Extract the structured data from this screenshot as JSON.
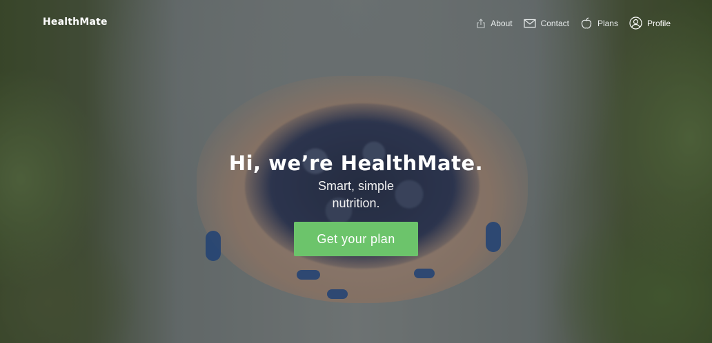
{
  "brand": {
    "name": "HealthMate"
  },
  "nav": {
    "items": [
      {
        "label": "About",
        "icon": "share-icon"
      },
      {
        "label": "Contact",
        "icon": "envelope-icon"
      },
      {
        "label": "Plans",
        "icon": "apple-icon"
      },
      {
        "label": "Profile",
        "icon": "user-icon"
      }
    ]
  },
  "hero": {
    "headline": "Hi, we’re HealthMate.",
    "subline_line1": "Smart, simple",
    "subline_line2": "nutrition.",
    "cta_label": "Get your plan"
  },
  "colors": {
    "cta_background": "#6cc46b",
    "text": "#ffffff",
    "nail_polish": "#2f5fae"
  }
}
